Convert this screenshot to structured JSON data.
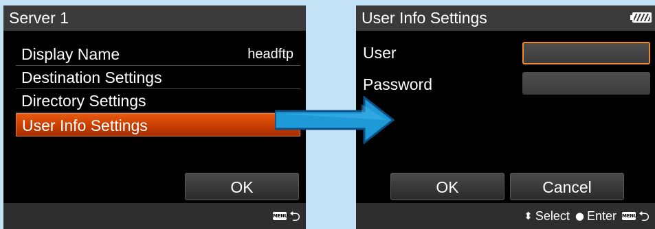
{
  "left_screen": {
    "title": "Server 1",
    "menu": [
      {
        "label": "Display Name",
        "value": "headftp",
        "selected": false
      },
      {
        "label": "Destination Settings",
        "value": "",
        "selected": false
      },
      {
        "label": "Directory Settings",
        "value": "",
        "selected": false
      },
      {
        "label": "User Info Settings",
        "value": "",
        "selected": true
      }
    ],
    "ok_label": "OK",
    "footer": {
      "menu_icon": "menu-icon",
      "back_icon": "return-icon"
    }
  },
  "right_screen": {
    "title": "User Info Settings",
    "battery_icon": "battery-icon",
    "fields": {
      "user_label": "User",
      "user_value": "",
      "password_label": "Password",
      "password_value": ""
    },
    "ok_label": "OK",
    "cancel_label": "Cancel",
    "footer": {
      "select_icon": "updown-icon",
      "select_label": "Select",
      "enter_icon": "dot-icon",
      "enter_label": "Enter",
      "menu_icon": "menu-icon",
      "back_icon": "return-icon"
    }
  },
  "colors": {
    "background": "#c4e2f6",
    "selection": "#d84a08",
    "focus_border": "#f08a24",
    "arrow": "#1e9bd7"
  }
}
